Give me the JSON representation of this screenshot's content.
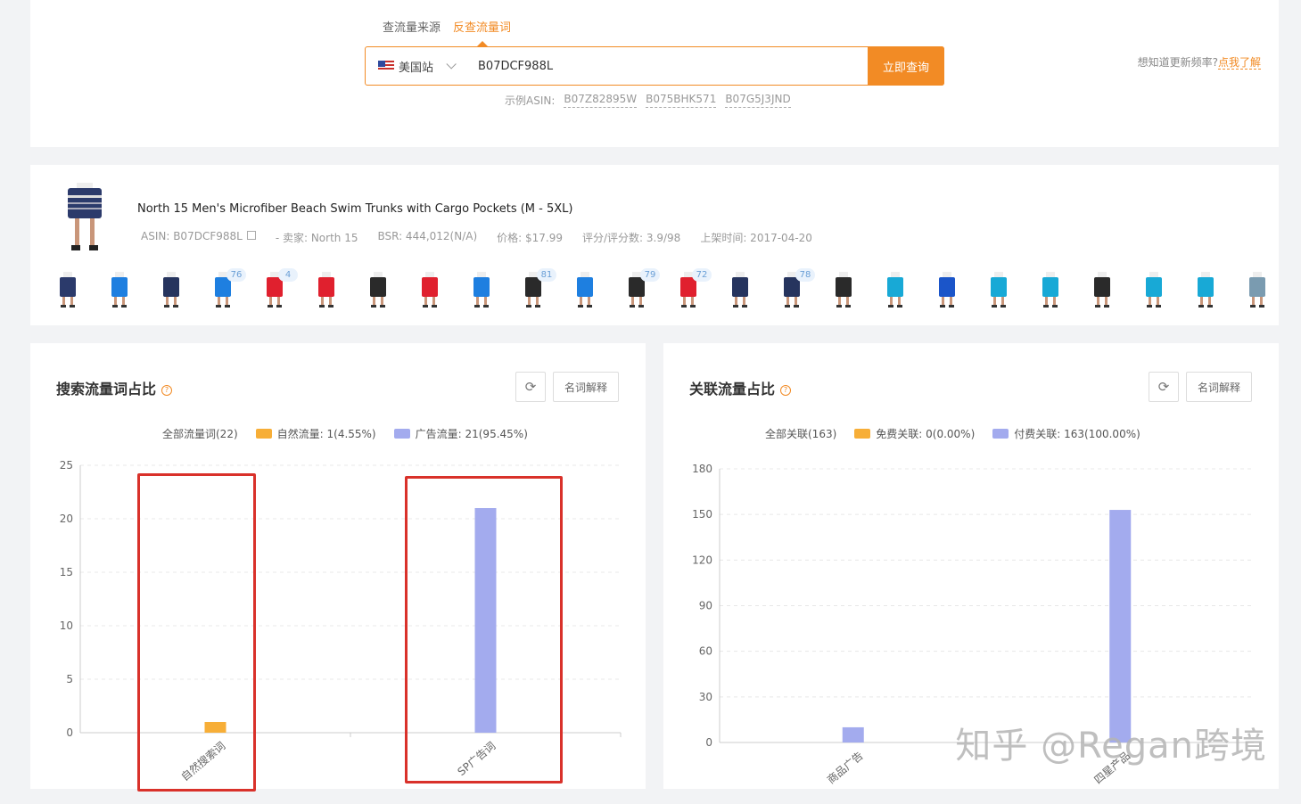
{
  "search": {
    "tabs": [
      "查流量来源",
      "反查流量词"
    ],
    "active_tab": 1,
    "site_label": "美国站",
    "query_value": "B07DCF988L",
    "button_label": "立即查询",
    "examples_label": "示例ASIN:",
    "examples": [
      "B07Z82895W",
      "B075BHK571",
      "B07G5J3JND"
    ],
    "update_hint": "想知道更新频率?",
    "update_link": "点我了解"
  },
  "product": {
    "title": "North 15 Men's Microfiber Beach Swim Trunks with Cargo Pockets (M - 5XL)",
    "asin": "ASIN: B07DCF988L",
    "seller": "- 卖家: North 15",
    "bsr": "BSR: 444,012(N/A)",
    "price": "价格: $17.99",
    "rating": "评分/评分数: 3.9/98",
    "listed": "上架时间: 2017-04-20",
    "variants": [
      {
        "color": "#2b3a6b",
        "badge": ""
      },
      {
        "color": "#1e7fe0",
        "badge": ""
      },
      {
        "color": "#26345e",
        "badge": ""
      },
      {
        "color": "#1e7fe0",
        "badge": "76"
      },
      {
        "color": "#e0202e",
        "badge": "4"
      },
      {
        "color": "#e0202e",
        "badge": ""
      },
      {
        "color": "#2a2a2a",
        "badge": ""
      },
      {
        "color": "#e0202e",
        "badge": ""
      },
      {
        "color": "#1e7fe0",
        "badge": ""
      },
      {
        "color": "#2a2a2a",
        "badge": "81"
      },
      {
        "color": "#1e7fe0",
        "badge": ""
      },
      {
        "color": "#2a2a2a",
        "badge": "79"
      },
      {
        "color": "#e0202e",
        "badge": "72"
      },
      {
        "color": "#26345e",
        "badge": ""
      },
      {
        "color": "#26345e",
        "badge": "78"
      },
      {
        "color": "#2a2a2a",
        "badge": ""
      },
      {
        "color": "#18a9d6",
        "badge": ""
      },
      {
        "color": "#1b55c9",
        "badge": ""
      },
      {
        "color": "#18a9d6",
        "badge": ""
      },
      {
        "color": "#18a9d6",
        "badge": ""
      },
      {
        "color": "#2a2a2a",
        "badge": ""
      },
      {
        "color": "#18a9d6",
        "badge": ""
      },
      {
        "color": "#18a9d6",
        "badge": ""
      },
      {
        "color": "#7a9bb0",
        "badge": ""
      }
    ]
  },
  "keyword_panel": {
    "title": "搜索流量词占比",
    "glossary": "名词解释",
    "legend": [
      "全部流量词(22)",
      "自然流量: 1(4.55%)",
      "广告流量: 21(95.45%)"
    ]
  },
  "relation_panel": {
    "title": "关联流量占比",
    "glossary": "名词解释",
    "legend": [
      "全部关联(163)",
      "免费关联: 0(0.00%)",
      "付费关联: 163(100.00%)"
    ]
  },
  "colors": {
    "accent": "#f28b25",
    "organic": "#f7ae37",
    "paid": "#a3abee",
    "highlight": "#d9312a"
  },
  "watermark": "知乎 @Regan跨境",
  "chart_data": [
    {
      "type": "bar",
      "categories": [
        "自然搜索词",
        "SP广告词"
      ],
      "series": [
        {
          "name": "自然流量",
          "values": [
            1,
            0
          ],
          "color": "#f7ae37"
        },
        {
          "name": "广告流量",
          "values": [
            0,
            21
          ],
          "color": "#a3abee"
        }
      ],
      "yticks": [
        0,
        5,
        10,
        15,
        20,
        25
      ],
      "ylim": [
        0,
        25
      ],
      "grid": true
    },
    {
      "type": "bar",
      "categories": [
        "商品广告",
        "四星产品"
      ],
      "series": [
        {
          "name": "付费关联",
          "values": [
            10,
            153
          ],
          "color": "#a3abee"
        }
      ],
      "yticks": [
        0,
        30,
        60,
        90,
        120,
        150,
        180
      ],
      "ylim": [
        0,
        180
      ],
      "grid": true
    }
  ]
}
